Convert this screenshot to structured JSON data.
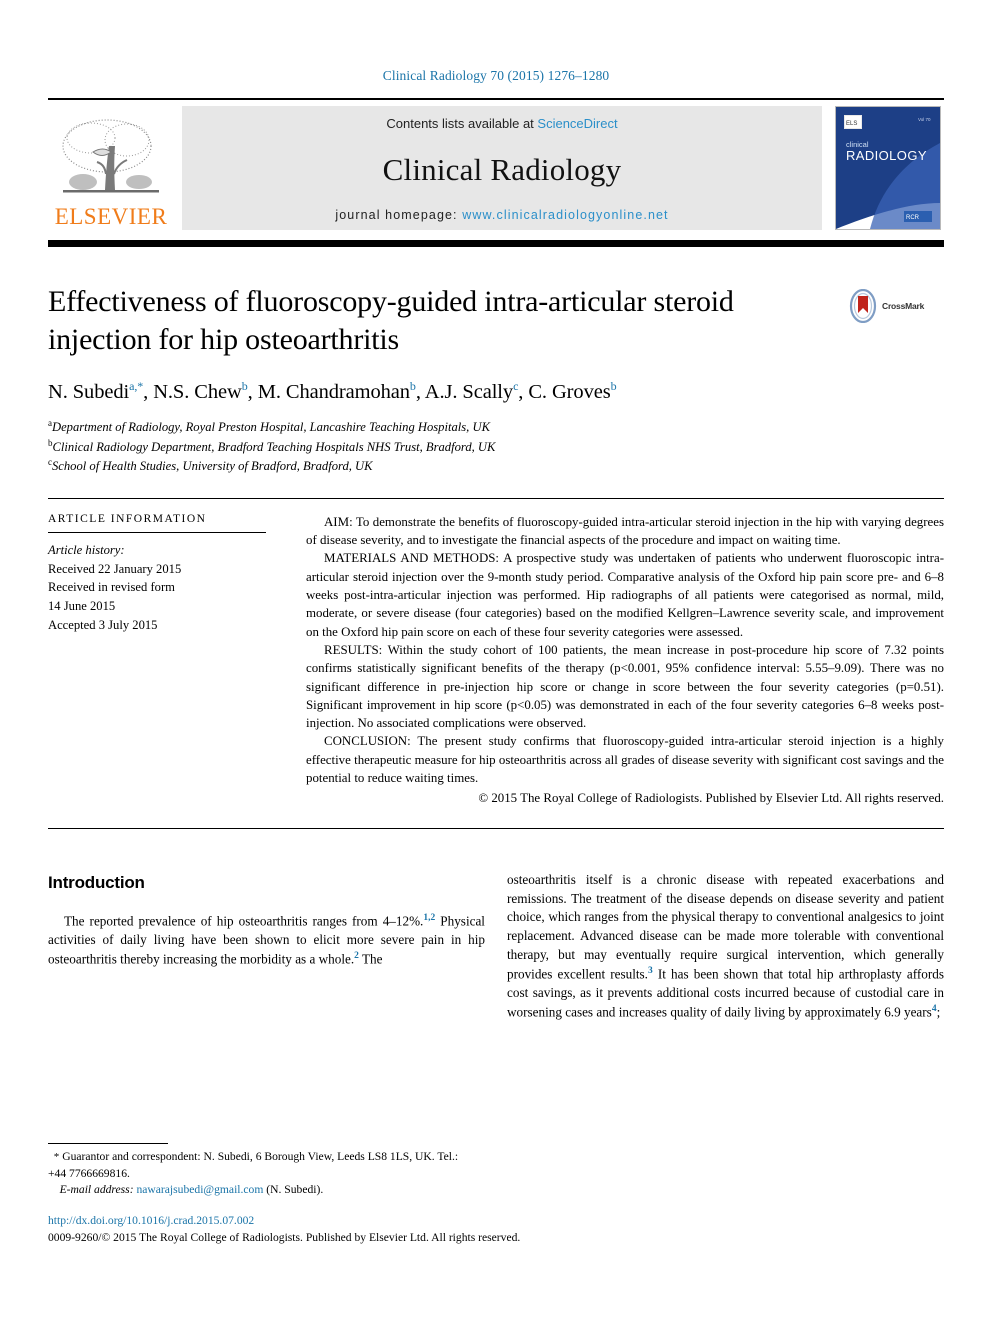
{
  "running_head": "Clinical Radiology 70 (2015) 1276–1280",
  "masthead": {
    "publisher_logo_text": "ELSEVIER",
    "contents_prefix": "Contents lists available at ",
    "contents_link": "ScienceDirect",
    "journal_name": "Clinical Radiology",
    "homepage_prefix": "journal homepage: ",
    "homepage_url": "www.clinicalradiologyonline.net",
    "cover_title_small": "clinical",
    "cover_title_large": "RADIOLOGY"
  },
  "article": {
    "title": "Effectiveness of fluoroscopy-guided intra-articular steroid injection for hip osteoarthritis",
    "crossmark_label": "CrossMark",
    "authors": [
      {
        "name": "N. Subedi",
        "marks": "a,*"
      },
      {
        "name": "N.S. Chew",
        "marks": "b"
      },
      {
        "name": "M. Chandramohan",
        "marks": "b"
      },
      {
        "name": "A.J. Scally",
        "marks": "c"
      },
      {
        "name": "C. Groves",
        "marks": "b"
      }
    ],
    "affiliations": [
      {
        "mark": "a",
        "text": "Department of Radiology, Royal Preston Hospital, Lancashire Teaching Hospitals, UK"
      },
      {
        "mark": "b",
        "text": "Clinical Radiology Department, Bradford Teaching Hospitals NHS Trust, Bradford, UK"
      },
      {
        "mark": "c",
        "text": "School of Health Studies, University of Bradford, Bradford, UK"
      }
    ]
  },
  "article_information": {
    "heading": "Article information",
    "history_label": "Article history:",
    "history_lines": [
      "Received 22 January 2015",
      "Received in revised form",
      "14 June 2015",
      "Accepted 3 July 2015"
    ]
  },
  "abstract": {
    "aim_label": "AIM:",
    "aim_text": " To demonstrate the benefits of fluoroscopy-guided intra-articular steroid injection in the hip with varying degrees of disease severity, and to investigate the financial aspects of the procedure and impact on waiting time.",
    "methods_label": "MATERIALS AND METHODS:",
    "methods_text": " A prospective study was undertaken of patients who underwent fluoroscopic intra-articular steroid injection over the 9-month study period. Comparative analysis of the Oxford hip pain score pre- and 6–8 weeks post-intra-articular injection was performed. Hip radiographs of all patients were categorised as normal, mild, moderate, or severe disease (four categories) based on the modified Kellgren–Lawrence severity scale, and improvement on the Oxford hip pain score on each of these four severity categories were assessed.",
    "results_label": "RESULTS:",
    "results_text": " Within the study cohort of 100 patients, the mean increase in post-procedure hip score of 7.32 points confirms statistically significant benefits of the therapy (p<0.001, 95% confidence interval: 5.55–9.09). There was no significant difference in pre-injection hip score or change in score between the four severity categories (p=0.51). Significant improvement in hip score (p<0.05) was demonstrated in each of the four severity categories 6–8 weeks post-injection. No associated complications were observed.",
    "conclusion_label": "CONCLUSION:",
    "conclusion_text": " The present study confirms that fluoroscopy-guided intra-articular steroid injection is a highly effective therapeutic measure for hip osteoarthritis across all grades of disease severity with significant cost savings and the potential to reduce waiting times.",
    "copyright": "© 2015 The Royal College of Radiologists. Published by Elsevier Ltd. All rights reserved."
  },
  "body": {
    "section_heading": "Introduction",
    "left_paragraph_part1": "The reported prevalence of hip osteoarthritis ranges from 4–12%.",
    "left_ref_1": "1,2",
    "left_paragraph_part2": " Physical activities of daily living have been shown to elicit more severe pain in hip osteoarthritis thereby increasing the morbidity as a whole.",
    "left_ref_2": "2",
    "left_paragraph_part3": " The",
    "right_paragraph_part1": "osteoarthritis itself is a chronic disease with repeated exacerbations and remissions. The treatment of the disease depends on disease severity and patient choice, which ranges from the physical therapy to conventional analgesics to joint replacement. Advanced disease can be made more tolerable with conventional therapy, but may eventually require surgical intervention, which generally provides excellent results.",
    "right_ref_3": "3",
    "right_paragraph_part2": " It has been shown that total hip arthroplasty affords cost savings, as it prevents additional costs incurred because of custodial care in worsening cases and increases quality of daily living by approximately 6.9 years",
    "right_ref_4": "4",
    "right_paragraph_part3": ";"
  },
  "footnote": {
    "star": "*",
    "correspondence": " Guarantor and correspondent: N. Subedi, 6 Borough View, Leeds LS8 1LS, UK. Tel.: +44 7766669816.",
    "email_label": "E-mail address:",
    "email": "nawarajsubedi@gmail.com",
    "email_suffix": " (N. Subedi)."
  },
  "footer": {
    "doi": "http://dx.doi.org/10.1016/j.crad.2015.07.002",
    "issn_line": "0009-9260/© 2015 The Royal College of Radiologists. Published by Elsevier Ltd. All rights reserved."
  },
  "colors": {
    "link_blue": "#1a74a8",
    "sciencedirect_blue": "#2b8fc9",
    "elsevier_orange": "#f07c1a",
    "masthead_gray": "#e7e7e7",
    "cover_blue": "#1d3f86"
  }
}
